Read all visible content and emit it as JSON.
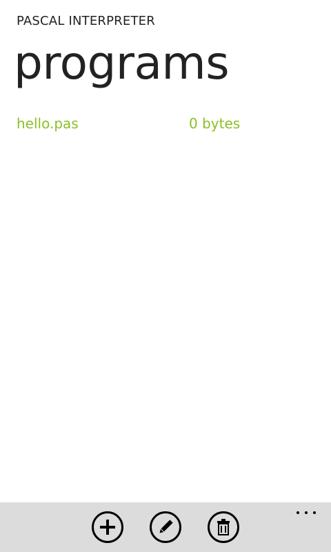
{
  "app": {
    "title": "PASCAL INTERPRETER",
    "page_title": "programs",
    "accent_color": "#8cbf26"
  },
  "programs": [
    {
      "name": "hello.pas",
      "size": "0 bytes"
    }
  ],
  "appbar": {
    "buttons": [
      {
        "icon": "add-icon"
      },
      {
        "icon": "edit-icon"
      },
      {
        "icon": "delete-icon"
      }
    ],
    "more_icon": "more-icon"
  }
}
